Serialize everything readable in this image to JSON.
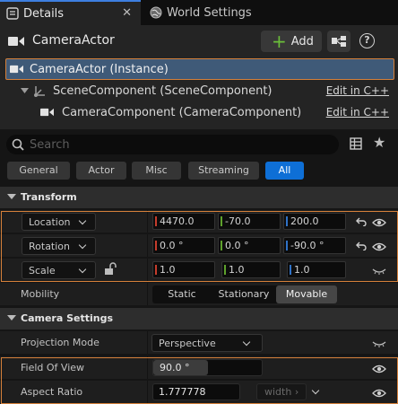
{
  "tabs": [
    {
      "label": "Details",
      "icon": "details-icon",
      "active": true
    },
    {
      "label": "World Settings",
      "icon": "globe-icon",
      "active": false
    }
  ],
  "tab_close": "✕",
  "header": {
    "title": "CameraActor",
    "add_label": "Add",
    "add_symbol": "+",
    "help_symbol": "?"
  },
  "tree": [
    {
      "label": "CameraActor (Instance)",
      "icon": "camera-icon",
      "selected": true
    },
    {
      "label": "SceneComponent (SceneComponent)",
      "icon": "scene-component-icon",
      "action": "Edit in C++"
    },
    {
      "label": "CameraComponent (CameraComponent)",
      "icon": "camera-icon",
      "action": "Edit in C++"
    }
  ],
  "search": {
    "placeholder": "Search"
  },
  "filters": [
    {
      "label": "General",
      "active": false
    },
    {
      "label": "Actor",
      "active": false
    },
    {
      "label": "Misc",
      "active": false
    },
    {
      "label": "Streaming",
      "active": false
    },
    {
      "label": "All",
      "active": true
    }
  ],
  "transform": {
    "title": "Transform",
    "location": {
      "label": "Location",
      "x": "4470.0",
      "y": "-70.0",
      "z": "200.0"
    },
    "rotation": {
      "label": "Rotation",
      "x": "0.0 °",
      "y": "0.0 °",
      "z": "-90.0 °"
    },
    "scale": {
      "label": "Scale",
      "x": "1.0",
      "y": "1.0",
      "z": "1.0"
    },
    "mobility": {
      "label": "Mobility",
      "options": [
        "Static",
        "Stationary",
        "Movable"
      ],
      "selected": "Movable"
    }
  },
  "camera_settings": {
    "title": "Camera Settings",
    "projection_mode": {
      "label": "Projection Mode",
      "value": "Perspective"
    },
    "field_of_view": {
      "label": "Field Of View",
      "value": "90.0 °",
      "fraction": 0.5
    },
    "aspect_ratio": {
      "label": "Aspect Ratio",
      "value": "1.777778",
      "unit_button": "width ›"
    }
  },
  "colors": {
    "accent_blue": "#0e6fd6",
    "selection_outline": "#d5803a",
    "axis_x": "#c53c2c",
    "axis_y": "#5ea12c",
    "axis_z": "#2f72c7",
    "add_green": "#6bbf3a"
  }
}
